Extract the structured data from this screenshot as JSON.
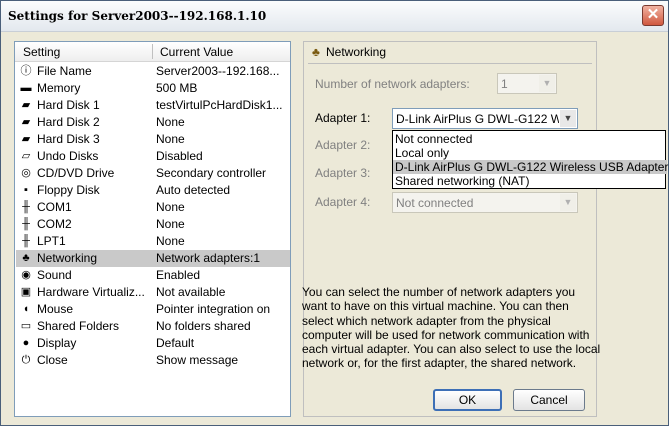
{
  "window": {
    "title": "Settings for Server2003--192.168.1.10",
    "close_glyph": "✕"
  },
  "list": {
    "col_setting": "Setting",
    "col_value": "Current Value",
    "rows": [
      {
        "name": "File Name",
        "value": "Server2003--192.168...",
        "icon": "info-icon"
      },
      {
        "name": "Memory",
        "value": "500 MB",
        "icon": "memory-icon"
      },
      {
        "name": "Hard Disk 1",
        "value": "testVirtulPcHardDisk1...",
        "icon": "hard-disk-icon"
      },
      {
        "name": "Hard Disk 2",
        "value": "None",
        "icon": "hard-disk-icon"
      },
      {
        "name": "Hard Disk 3",
        "value": "None",
        "icon": "hard-disk-icon"
      },
      {
        "name": "Undo Disks",
        "value": "Disabled",
        "icon": "undo-disk-icon"
      },
      {
        "name": "CD/DVD Drive",
        "value": "Secondary controller",
        "icon": "cd-icon"
      },
      {
        "name": "Floppy Disk",
        "value": "Auto detected",
        "icon": "floppy-icon"
      },
      {
        "name": "COM1",
        "value": "None",
        "icon": "com-port-icon"
      },
      {
        "name": "COM2",
        "value": "None",
        "icon": "com-port-icon"
      },
      {
        "name": "LPT1",
        "value": "None",
        "icon": "lpt-port-icon"
      },
      {
        "name": "Networking",
        "value": "Network adapters:1",
        "icon": "network-icon"
      },
      {
        "name": "Sound",
        "value": "Enabled",
        "icon": "sound-icon"
      },
      {
        "name": "Hardware Virtualiz...",
        "value": "Not available",
        "icon": "hardware-icon"
      },
      {
        "name": "Mouse",
        "value": "Pointer integration on",
        "icon": "mouse-icon"
      },
      {
        "name": "Shared Folders",
        "value": "No folders shared",
        "icon": "folder-icon"
      },
      {
        "name": "Display",
        "value": "Default",
        "icon": "display-icon"
      },
      {
        "name": "Close",
        "value": "Show message",
        "icon": "close-action-icon"
      }
    ],
    "selected_index": 11
  },
  "panel": {
    "title": "Networking",
    "num_adapters_label": "Number of network adapters:",
    "num_adapters_value": "1",
    "adapters": [
      {
        "label": "Adapter 1:",
        "value": "D-Link AirPlus G DWL-G122 Wireless USB Adapter",
        "enabled": true
      },
      {
        "label": "Adapter 2:",
        "value": "",
        "enabled": false
      },
      {
        "label": "Adapter 3:",
        "value": "",
        "enabled": false
      },
      {
        "label": "Adapter 4:",
        "value": "Not connected",
        "enabled": false
      }
    ],
    "dropdown_options": [
      "Not connected",
      "Local only",
      "D-Link AirPlus G DWL-G122 Wireless USB Adapter",
      "Shared networking (NAT)"
    ],
    "dropdown_highlight_index": 2,
    "help_text": "You can select the number of network adapters you want to have on this virtual machine. You can then select which network adapter from the physical computer will be used for network communication with each virtual adapter. You can also select to use the local network or, for the first adapter, the shared network."
  },
  "buttons": {
    "ok": "OK",
    "cancel": "Cancel"
  }
}
